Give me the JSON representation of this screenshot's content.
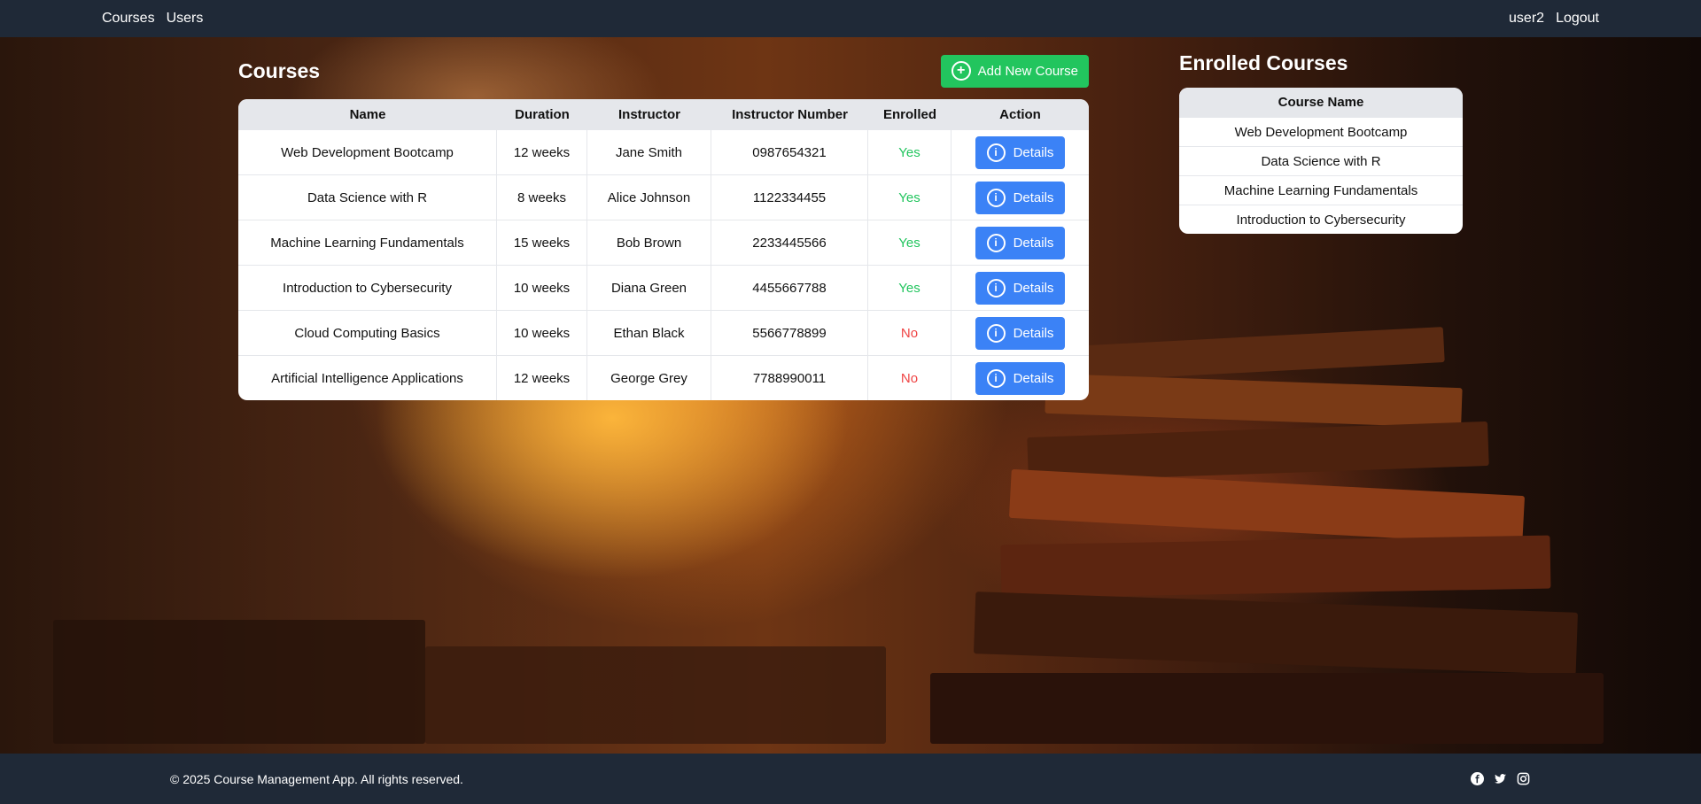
{
  "nav": {
    "links": [
      "Courses",
      "Users"
    ],
    "user": "user2",
    "logout": "Logout"
  },
  "courses": {
    "title": "Courses",
    "add_button": "Add New Course",
    "columns": [
      "Name",
      "Duration",
      "Instructor",
      "Instructor Number",
      "Enrolled",
      "Action"
    ],
    "rows": [
      {
        "name": "Web Development Bootcamp",
        "duration": "12 weeks",
        "instructor": "Jane Smith",
        "number": "0987654321",
        "enrolled": "Yes",
        "action": "Details"
      },
      {
        "name": "Data Science with R",
        "duration": "8 weeks",
        "instructor": "Alice Johnson",
        "number": "1122334455",
        "enrolled": "Yes",
        "action": "Details"
      },
      {
        "name": "Machine Learning Fundamentals",
        "duration": "15 weeks",
        "instructor": "Bob Brown",
        "number": "2233445566",
        "enrolled": "Yes",
        "action": "Details"
      },
      {
        "name": "Introduction to Cybersecurity",
        "duration": "10 weeks",
        "instructor": "Diana Green",
        "number": "4455667788",
        "enrolled": "Yes",
        "action": "Details"
      },
      {
        "name": "Cloud Computing Basics",
        "duration": "10 weeks",
        "instructor": "Ethan Black",
        "number": "5566778899",
        "enrolled": "No",
        "action": "Details"
      },
      {
        "name": "Artificial Intelligence Applications",
        "duration": "12 weeks",
        "instructor": "George Grey",
        "number": "7788990011",
        "enrolled": "No",
        "action": "Details"
      }
    ]
  },
  "enrolled": {
    "title": "Enrolled Courses",
    "column": "Course Name",
    "rows": [
      "Web Development Bootcamp",
      "Data Science with R",
      "Machine Learning Fundamentals",
      "Introduction to Cybersecurity"
    ]
  },
  "footer": {
    "copyright": "© 2025 Course Management App. All rights reserved.",
    "social_icons": [
      "facebook-icon",
      "twitter-icon",
      "instagram-icon"
    ]
  },
  "colors": {
    "nav_bg": "#1f2937",
    "add_button": "#22c55e",
    "details_button": "#3b82f6",
    "enrolled_yes": "#22c55e",
    "enrolled_no": "#ef4444"
  }
}
